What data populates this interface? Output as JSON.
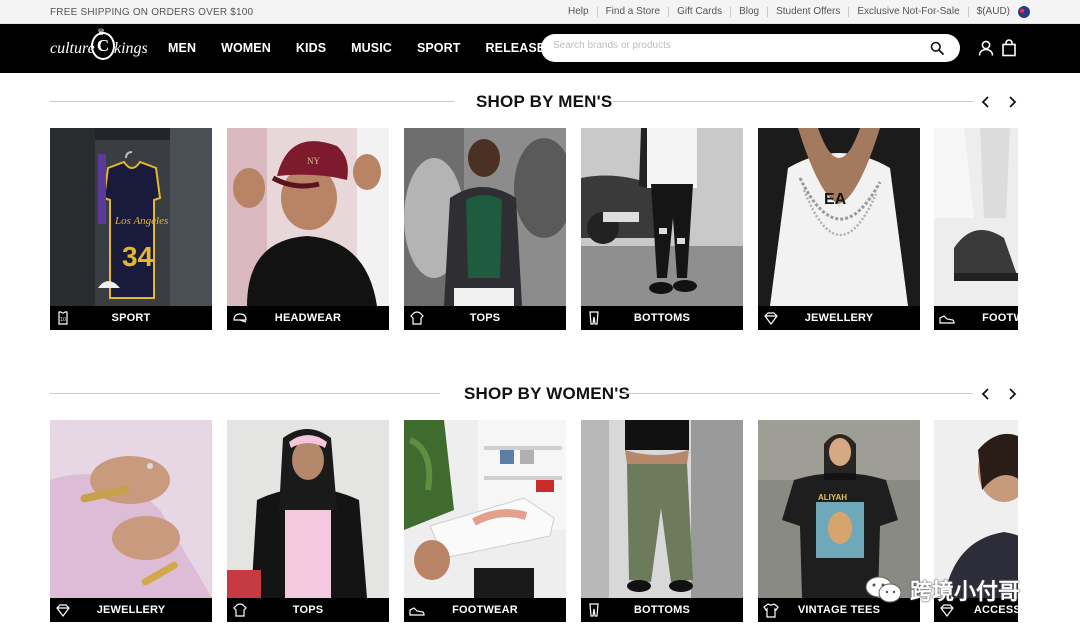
{
  "promo": {
    "text": "FREE SHIPPING ON ORDERS OVER $100"
  },
  "util_links": [
    "Help",
    "Find a Store",
    "Gift Cards",
    "Blog",
    "Student Offers",
    "Exclusive Not-For-Sale",
    "$(AUD)"
  ],
  "logo": {
    "left": "culture",
    "mark": "C",
    "right": "kings"
  },
  "nav": [
    "MEN",
    "WOMEN",
    "KIDS",
    "MUSIC",
    "SPORT",
    "RELEASES"
  ],
  "search": {
    "placeholder": "Search brands or products"
  },
  "sections": [
    {
      "title": "SHOP BY MEN'S",
      "cards": [
        {
          "label": "SPORT",
          "icon": "jersey-icon"
        },
        {
          "label": "HEADWEAR",
          "icon": "cap-icon"
        },
        {
          "label": "TOPS",
          "icon": "hoodie-icon"
        },
        {
          "label": "BOTTOMS",
          "icon": "pants-icon"
        },
        {
          "label": "JEWELLERY",
          "icon": "diamond-icon"
        },
        {
          "label": "FOOTWEAR",
          "icon": "sneaker-icon"
        }
      ]
    },
    {
      "title": "SHOP BY WOMEN'S",
      "cards": [
        {
          "label": "JEWELLERY",
          "icon": "diamond-icon"
        },
        {
          "label": "TOPS",
          "icon": "hoodie-icon"
        },
        {
          "label": "FOOTWEAR",
          "icon": "sneaker-icon"
        },
        {
          "label": "BOTTOMS",
          "icon": "pants-icon"
        },
        {
          "label": "VINTAGE TEES",
          "icon": "tshirt-icon"
        },
        {
          "label": "ACCESSORIES",
          "icon": "diamond-icon"
        }
      ]
    }
  ],
  "watermark": {
    "text": "跨境小付哥"
  },
  "colors": {
    "header_bg": "#000000",
    "utility_bg": "#f4f4f4",
    "card_label_bg": "#000000",
    "text": "#111111"
  }
}
